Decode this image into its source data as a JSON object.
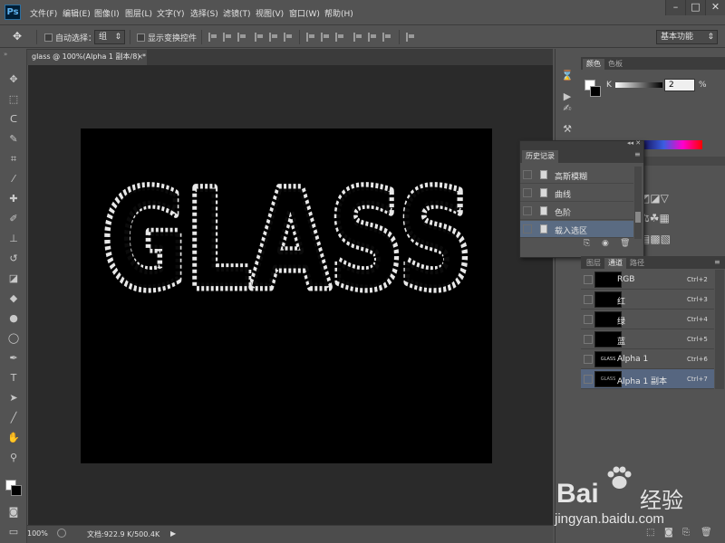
{
  "menubar": {
    "logo": "Ps",
    "items": [
      "文件(F)",
      "编辑(E)",
      "图像(I)",
      "图层(L)",
      "文字(Y)",
      "选择(S)",
      "滤镜(T)",
      "视图(V)",
      "窗口(W)",
      "帮助(H)"
    ]
  },
  "options": {
    "auto_select_label": "自动选择：",
    "auto_select_value": "组",
    "show_transform_label": "显示变换控件",
    "workspace": "基本功能"
  },
  "document": {
    "tab_title": "glass @ 100%(Alpha 1 副本/8) *",
    "canvas_text": "GLASS"
  },
  "status": {
    "zoom": "100%",
    "doc_info": "文档:922.9 K/500.4K"
  },
  "color_panel": {
    "tabs": [
      "颜色",
      "色板"
    ],
    "channel_label": "K",
    "value": "2",
    "unit": "%"
  },
  "history_panel": {
    "title": "历史记录",
    "items": [
      "高斯模糊",
      "曲线",
      "色阶",
      "载入选区"
    ],
    "selected_index": 3
  },
  "channels_panel": {
    "tabs": [
      "图层",
      "通道",
      "路径"
    ],
    "active_tab": "通道",
    "rows": [
      {
        "name": "RGB",
        "shortcut": "Ctrl+2",
        "thumb": ""
      },
      {
        "name": "红",
        "shortcut": "Ctrl+3",
        "thumb": ""
      },
      {
        "name": "绿",
        "shortcut": "Ctrl+4",
        "thumb": ""
      },
      {
        "name": "蓝",
        "shortcut": "Ctrl+5",
        "thumb": ""
      },
      {
        "name": "Alpha 1",
        "shortcut": "Ctrl+6",
        "thumb": "GLASS"
      },
      {
        "name": "Alpha 1 副本",
        "shortcut": "Ctrl+7",
        "thumb": "GLASS"
      }
    ],
    "selected_index": 5
  },
  "watermark": {
    "brand": "Bai",
    "brand2": "经验",
    "url": "jingyan.baidu.com"
  },
  "colors": {
    "accent_selection": "#566680",
    "canvas_bg": "#2a2a2a",
    "document_bg": "#000000",
    "text_outline": "#ffffff"
  }
}
